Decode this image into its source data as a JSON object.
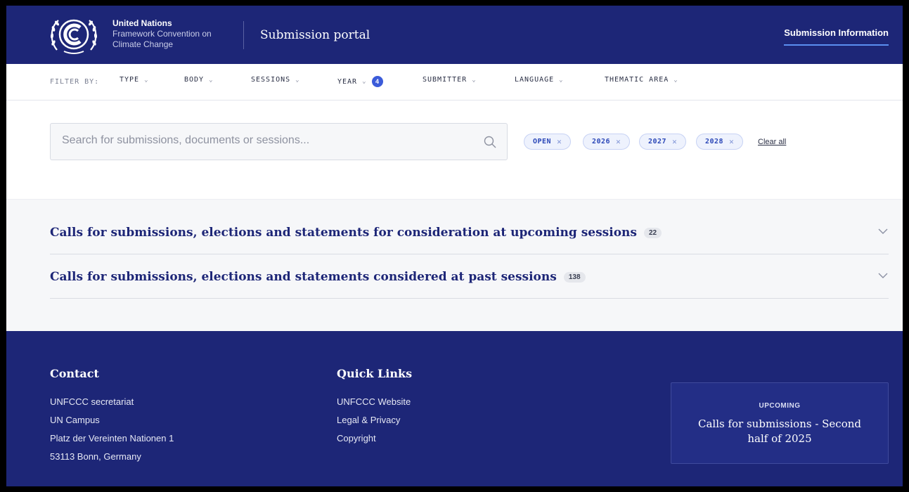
{
  "header": {
    "org_line1": "United Nations",
    "org_line2": "Framework Convention on",
    "org_line3": "Climate Change",
    "portal_title": "Submission portal",
    "nav_submission_info": "Submission Information",
    "brand_color": "#1d2677",
    "logo_icon": "un-emblem-icon"
  },
  "filters": {
    "label": "FILTER BY:",
    "items": [
      {
        "label": "TYPE"
      },
      {
        "label": "BODY"
      },
      {
        "label": "SESSIONS"
      },
      {
        "label": "YEAR",
        "badge": "4"
      },
      {
        "label": "SUBMITTER"
      },
      {
        "label": "LANGUAGE"
      },
      {
        "label": "THEMATIC AREA"
      }
    ]
  },
  "search": {
    "placeholder": "Search for submissions, documents or sessions...",
    "value": ""
  },
  "active_filters": {
    "chips": [
      {
        "label": "OPEN"
      },
      {
        "label": "2026"
      },
      {
        "label": "2027"
      },
      {
        "label": "2028"
      }
    ],
    "clear_all": "Clear all",
    "chip_color": "#2c48b8"
  },
  "sections": [
    {
      "title": "Calls for submissions, elections and statements for consideration at upcoming sessions",
      "count": "22"
    },
    {
      "title": "Calls for submissions, elections and statements considered at past sessions",
      "count": "138"
    }
  ],
  "footer": {
    "contact": {
      "heading": "Contact",
      "lines": [
        "UNFCCC secretariat",
        "UN Campus",
        "Platz der Vereinten Nationen 1",
        "53113 Bonn, Germany"
      ]
    },
    "quick_links": {
      "heading": "Quick Links",
      "links": [
        "UNFCCC Website",
        "Legal & Privacy",
        "Copyright"
      ]
    },
    "upcoming": {
      "label": "UPCOMING",
      "title": "Calls for submissions - Second half of 2025"
    }
  }
}
